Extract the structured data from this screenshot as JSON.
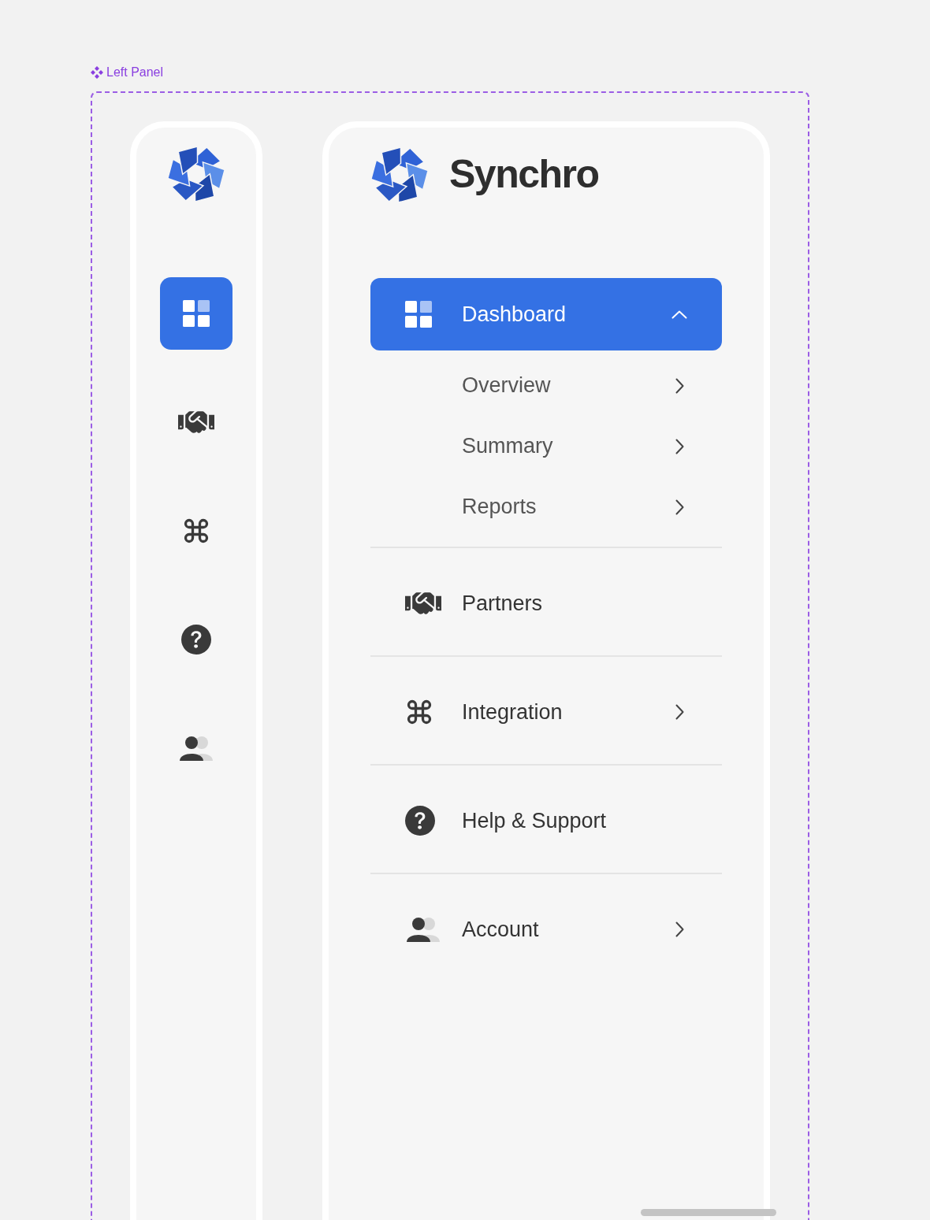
{
  "frame_label": "Left Panel",
  "brand": {
    "name": "Synchro"
  },
  "rail": [
    {
      "kind": "dashboard",
      "selected": true
    },
    {
      "kind": "partners",
      "selected": false
    },
    {
      "kind": "integration",
      "selected": false
    },
    {
      "kind": "help",
      "selected": false
    },
    {
      "kind": "account",
      "selected": false
    }
  ],
  "menu": [
    {
      "kind": "dashboard",
      "label": "Dashboard",
      "selected": true,
      "expanded": true,
      "has_submenu": true,
      "children": [
        {
          "label": "Overview"
        },
        {
          "label": "Summary"
        },
        {
          "label": "Reports"
        }
      ]
    },
    {
      "kind": "partners",
      "label": "Partners",
      "selected": false,
      "has_submenu": false
    },
    {
      "kind": "integration",
      "label": "Integration",
      "selected": false,
      "expanded": false,
      "has_submenu": true
    },
    {
      "kind": "help",
      "label": "Help & Support",
      "selected": false,
      "has_submenu": false
    },
    {
      "kind": "account",
      "label": "Account",
      "selected": false,
      "expanded": false,
      "has_submenu": true
    }
  ]
}
